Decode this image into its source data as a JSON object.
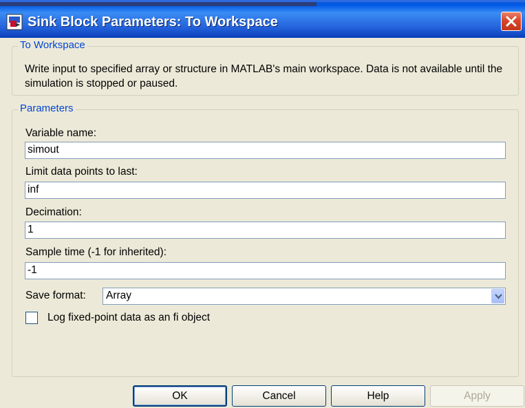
{
  "window": {
    "title": "Sink Block Parameters: To Workspace",
    "title_icon": "simulink-block-icon",
    "close_icon": "close-icon"
  },
  "description_group": {
    "legend": "To Workspace",
    "text": "Write input to specified array or structure in MATLAB's main workspace. Data is not available until the simulation is stopped or paused."
  },
  "parameters_group": {
    "legend": "Parameters",
    "variable_name": {
      "label": "Variable name:",
      "value": "simout"
    },
    "limit_points": {
      "label": "Limit data points to last:",
      "value": "inf"
    },
    "decimation": {
      "label": "Decimation:",
      "value": "1"
    },
    "sample_time": {
      "label": "Sample time (-1 for inherited):",
      "value": "-1"
    },
    "save_format": {
      "label": "Save format:",
      "value": "Array"
    },
    "log_fixed_point": {
      "label": "Log fixed-point data as an fi object",
      "checked": false
    }
  },
  "buttons": {
    "ok": "OK",
    "cancel": "Cancel",
    "help": "Help",
    "apply": "Apply"
  },
  "colors": {
    "titlebar": "#0058E6",
    "legend_text": "#0046D5",
    "dialog_bg": "#ECE9D8",
    "close_button": "#D8462C"
  }
}
